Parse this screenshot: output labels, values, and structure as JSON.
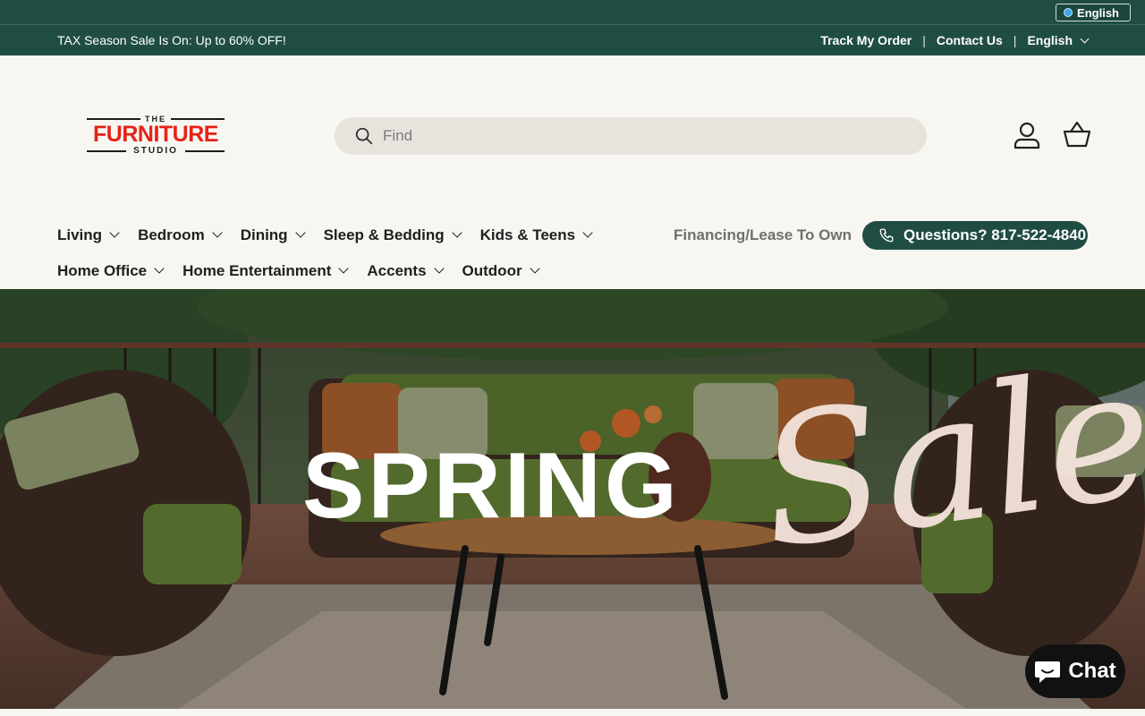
{
  "language_pill": {
    "label": "English"
  },
  "announcement": {
    "promo_text": "TAX Season Sale Is On: Up to 60% OFF!",
    "track_order": "Track My Order",
    "contact_us": "Contact Us",
    "language": "English",
    "separator": "|"
  },
  "header": {
    "logo": {
      "the": "THE",
      "main": "FURNITURE",
      "studio": "STUDIO"
    },
    "search": {
      "placeholder": "Find"
    },
    "icons": [
      "search-icon",
      "account-icon",
      "cart-icon"
    ]
  },
  "nav": {
    "row1": [
      {
        "label": "Living"
      },
      {
        "label": "Bedroom"
      },
      {
        "label": "Dining"
      },
      {
        "label": "Sleep & Bedding"
      },
      {
        "label": "Kids & Teens"
      }
    ],
    "row2": [
      {
        "label": "Home Office"
      },
      {
        "label": "Home Entertainment"
      },
      {
        "label": "Accents"
      },
      {
        "label": "Outdoor"
      }
    ],
    "financing": "Financing/Lease To Own",
    "phone_button": "Questions? 817-522-4840"
  },
  "hero": {
    "headline": "SPRING",
    "script": "Sale"
  },
  "chat": {
    "label": "Chat"
  },
  "colors": {
    "brand_green": "#204d43",
    "logo_red": "#e52317",
    "background": "#f8f6f1"
  }
}
